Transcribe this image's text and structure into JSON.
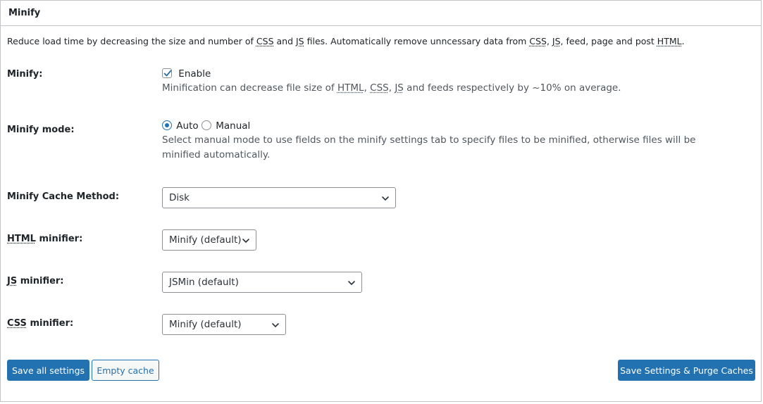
{
  "panel": {
    "title": "Minify",
    "intro": {
      "t1": "Reduce load time by decreasing the size and number of ",
      "css": "CSS",
      "t2": " and ",
      "js": "JS",
      "t3": " files. Automatically remove unncessary data from ",
      "css2": "CSS",
      "t4": ", ",
      "js2": "JS",
      "t5": ", feed, page and post ",
      "html": "HTML",
      "t6": "."
    }
  },
  "minify": {
    "label": "Minify:",
    "enable_label": "Enable",
    "enabled": true,
    "desc": {
      "t1": "Minification can decrease file size of ",
      "html": "HTML",
      "t2": ", ",
      "css": "CSS",
      "t3": ", ",
      "js": "JS",
      "t4": " and feeds respectively by ~10% on average."
    }
  },
  "mode": {
    "label": "Minify mode:",
    "auto_label": "Auto",
    "manual_label": "Manual",
    "selected": "Auto",
    "desc": "Select manual mode to use fields on the minify settings tab to specify files to be minified, otherwise files will be minified automatically."
  },
  "cache_method": {
    "label": "Minify Cache Method:",
    "value": "Disk"
  },
  "html_minifier": {
    "abbr": "HTML",
    "label_rest": " minifier:",
    "value": "Minify (default)"
  },
  "js_minifier": {
    "abbr": "JS",
    "label_rest": " minifier:",
    "value": "JSMin (default)"
  },
  "css_minifier": {
    "abbr": "CSS",
    "label_rest": " minifier:",
    "value": "Minify (default)"
  },
  "buttons": {
    "save_all": "Save all settings",
    "empty_cache": "Empty cache",
    "save_purge": "Save Settings & Purge Caches"
  },
  "colors": {
    "accent": "#2271b1",
    "border": "#8c8f94",
    "text": "#1d2327",
    "muted": "#50575e"
  },
  "icons": {
    "checkbox": "checkmark-icon",
    "select": "chevron-down-icon"
  }
}
